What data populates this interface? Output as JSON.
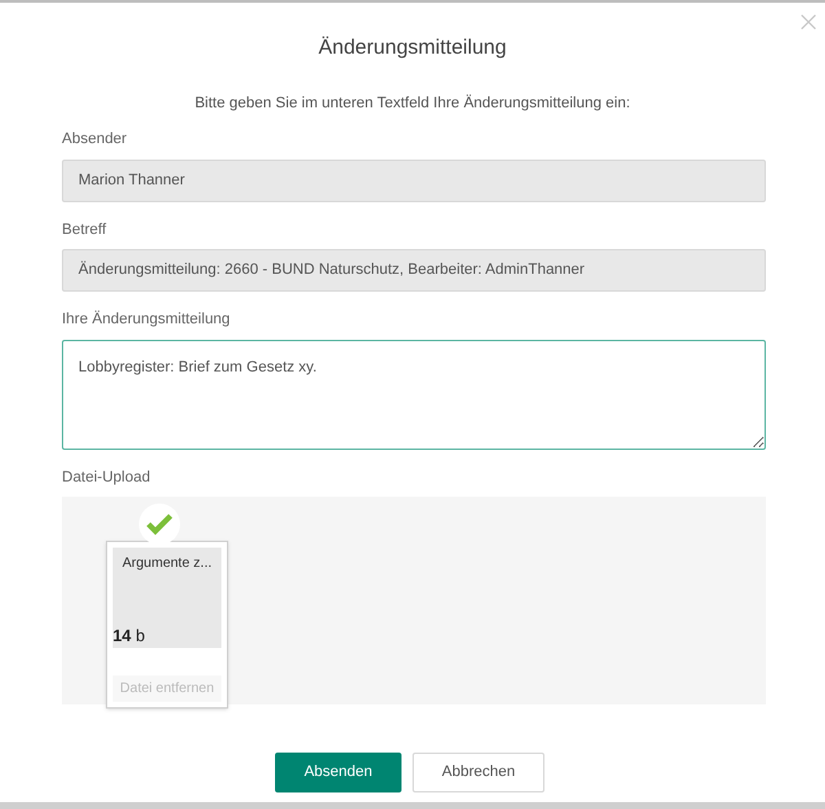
{
  "dialog": {
    "title": "Änderungsmitteilung",
    "instruction": "Bitte geben Sie im unteren Textfeld Ihre Änderungsmitteilung ein:"
  },
  "fields": [
    {
      "label": "Absender",
      "kind": "readonly",
      "value": "Marion Thanner"
    },
    {
      "label": "Betreff",
      "kind": "readonly",
      "value": "Änderungsmitteilung: 2660 - BUND Naturschutz, Bearbeiter: AdminThanner"
    },
    {
      "label": "Ihre Änderungsmitteilung",
      "kind": "textarea",
      "value": "Lobbyregister: Brief zum Gesetz xy."
    }
  ],
  "upload": {
    "label": "Datei-Upload",
    "files": [
      {
        "name": "Argumente z...",
        "size": "**14** b",
        "remove": "Datei entfernen",
        "uploaded": true
      }
    ]
  },
  "buttons": [
    {
      "label": "Absenden",
      "kind": "primary"
    },
    {
      "label": "Abbrechen",
      "kind": "secondary"
    }
  ]
}
